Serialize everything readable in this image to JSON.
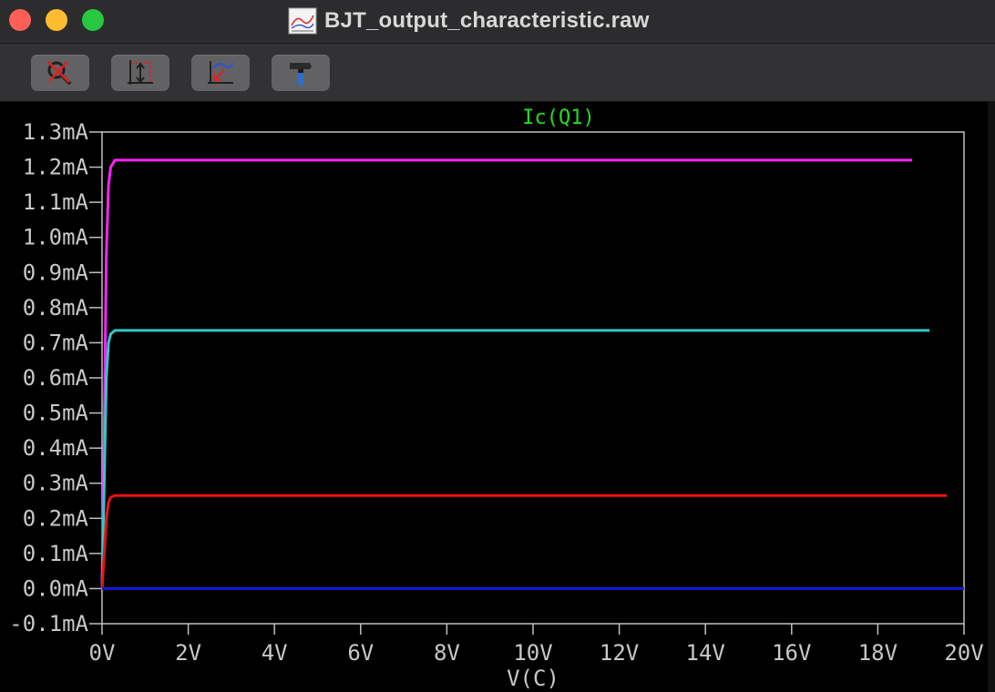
{
  "window": {
    "title": "BJT_output_characteristic.raw"
  },
  "toolbar": {
    "buttons": [
      {
        "name": "zoom-cancel-button",
        "icon": "magnifier-cross-icon"
      },
      {
        "name": "autorange-button",
        "icon": "autorange-icon"
      },
      {
        "name": "zoom-back-button",
        "icon": "zoom-back-icon"
      },
      {
        "name": "settings-button",
        "icon": "hammer-icon"
      }
    ]
  },
  "chart_data": {
    "type": "line",
    "title": "Ic(Q1)",
    "xlabel": "V(C)",
    "ylabel": "",
    "xlim": [
      0,
      20
    ],
    "ylim": [
      -0.1,
      1.3
    ],
    "grid": false,
    "x_ticks": [
      "0V",
      "2V",
      "4V",
      "6V",
      "8V",
      "10V",
      "12V",
      "14V",
      "16V",
      "18V",
      "20V"
    ],
    "y_ticks": [
      "1.3mA",
      "1.2mA",
      "1.1mA",
      "1.0mA",
      "0.9mA",
      "0.8mA",
      "0.7mA",
      "0.6mA",
      "0.5mA",
      "0.4mA",
      "0.3mA",
      "0.2mA",
      "0.1mA",
      "0.0mA",
      "-0.1mA"
    ],
    "colors": {
      "frame": "#c0c0c0",
      "title": "#22dd22",
      "axis_text": "#c8c8c8"
    },
    "series": [
      {
        "color": "#ff22ff",
        "x": [
          0,
          0.05,
          0.1,
          0.15,
          0.2,
          0.3,
          0.4,
          18.8
        ],
        "y": [
          0,
          0.45,
          0.95,
          1.15,
          1.2,
          1.22,
          1.22,
          1.22
        ]
      },
      {
        "color": "#33c8c8",
        "x": [
          0,
          0.05,
          0.1,
          0.15,
          0.2,
          0.3,
          0.4,
          19.2
        ],
        "y": [
          0,
          0.3,
          0.6,
          0.7,
          0.725,
          0.735,
          0.735,
          0.735
        ]
      },
      {
        "color": "#ee1111",
        "x": [
          0,
          0.05,
          0.1,
          0.15,
          0.2,
          0.3,
          0.4,
          19.6
        ],
        "y": [
          0,
          0.1,
          0.2,
          0.245,
          0.26,
          0.265,
          0.265,
          0.265
        ]
      },
      {
        "color": "#1818dd",
        "x": [
          0,
          20
        ],
        "y": [
          0,
          0
        ]
      }
    ]
  }
}
